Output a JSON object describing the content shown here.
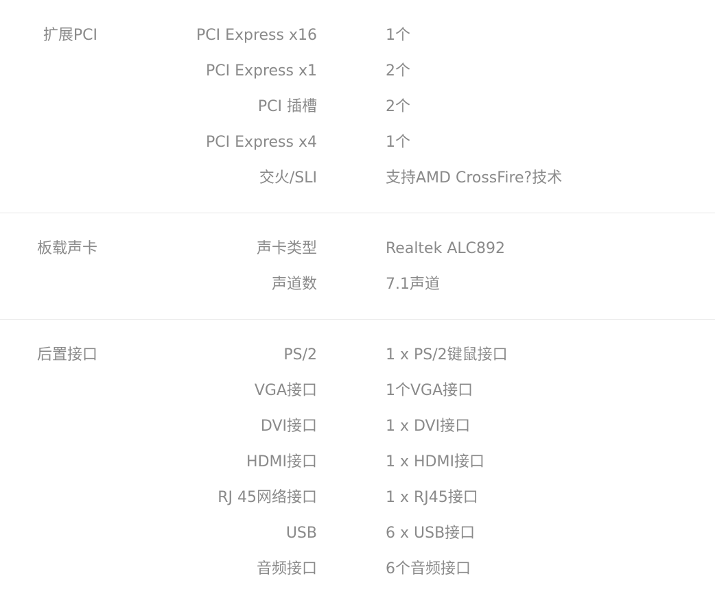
{
  "sections": [
    {
      "title": "扩展PCI",
      "rows": [
        {
          "label": "PCI Express x16",
          "value": "1个"
        },
        {
          "label": "PCI Express x1",
          "value": "2个"
        },
        {
          "label": "PCI 插槽",
          "value": "2个"
        },
        {
          "label": "PCI Express x4",
          "value": "1个"
        },
        {
          "label": "交火/SLI",
          "value": "支持AMD CrossFire?技术"
        }
      ]
    },
    {
      "title": "板载声卡",
      "rows": [
        {
          "label": "声卡类型",
          "value": "Realtek ALC892"
        },
        {
          "label": "声道数",
          "value": "7.1声道"
        }
      ]
    },
    {
      "title": "后置接口",
      "rows": [
        {
          "label": "PS/2",
          "value": "1 x PS/2键鼠接口"
        },
        {
          "label": "VGA接口",
          "value": "1个VGA接口"
        },
        {
          "label": "DVI接口",
          "value": "1 x DVI接口"
        },
        {
          "label": "HDMI接口",
          "value": "1 x HDMI接口"
        },
        {
          "label": "RJ 45网络接口",
          "value": "1 x RJ45接口"
        },
        {
          "label": "USB",
          "value": "6 x USB接口"
        },
        {
          "label": "音频接口",
          "value": "6个音频接口"
        }
      ]
    }
  ]
}
